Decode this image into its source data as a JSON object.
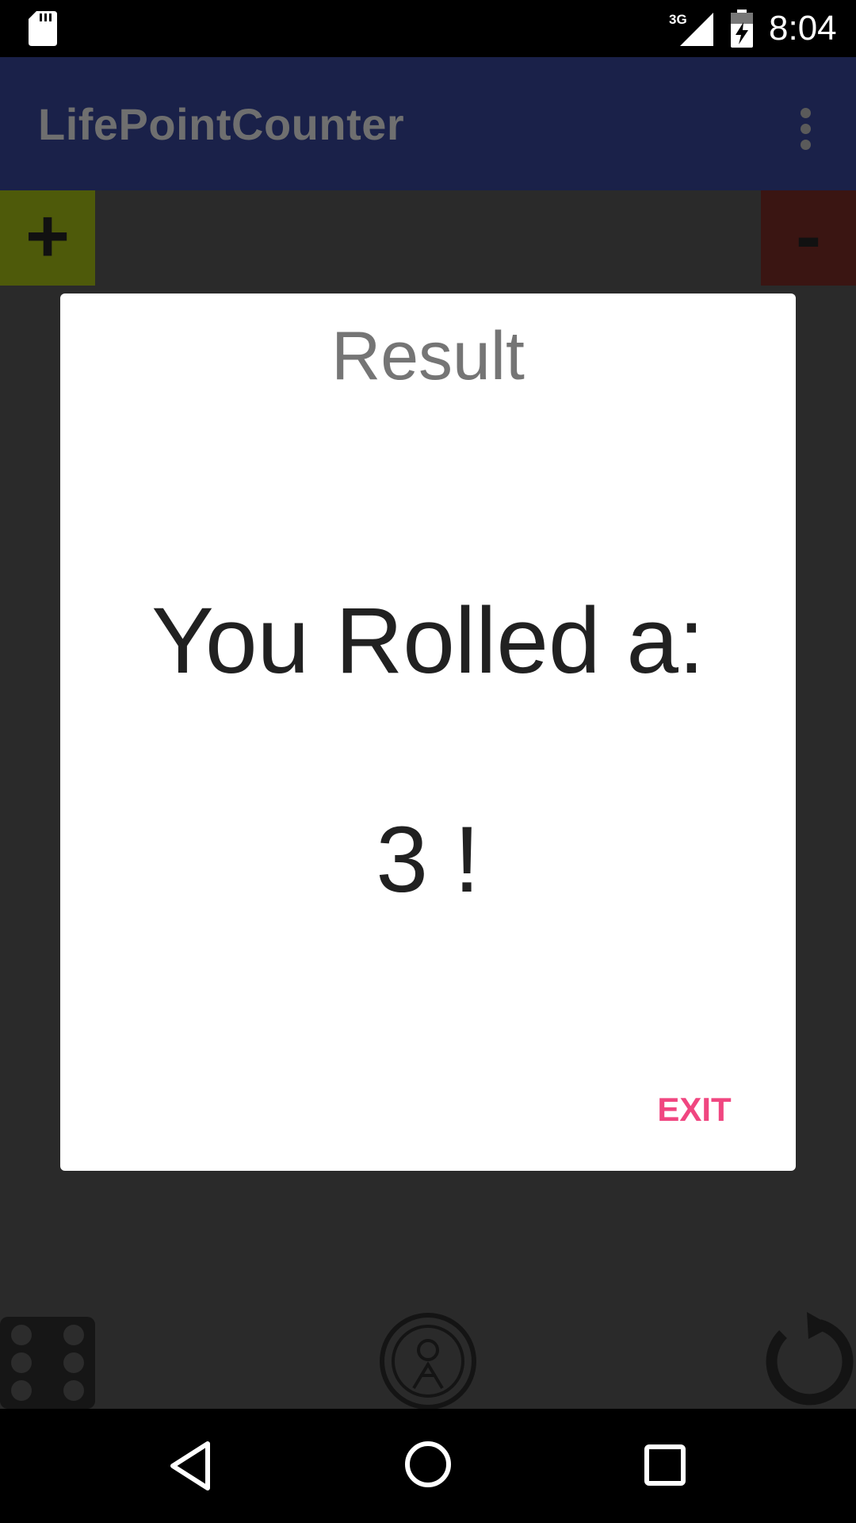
{
  "status_bar": {
    "time": "8:04",
    "network_label": "3G",
    "icons": [
      "sd-card-icon",
      "signal-3g-icon",
      "battery-charging-icon"
    ]
  },
  "app_bar": {
    "title": "LifePointCounter",
    "menu_icon": "overflow-menu-icon"
  },
  "counter_controls": {
    "plus_label": "+",
    "minus_label": "-",
    "plus_color": "#4e5a0a",
    "minus_color": "#3a1512"
  },
  "bottom_tools": {
    "icons": [
      "dice-icon",
      "coin-flip-icon",
      "reset-icon"
    ]
  },
  "dialog": {
    "title": "Result",
    "message": "You Rolled a:",
    "result": "3 !",
    "exit_label": "EXIT",
    "accent_color": "#f04680"
  },
  "nav_bar": {
    "icons": [
      "back-icon",
      "home-icon",
      "recents-icon"
    ]
  }
}
